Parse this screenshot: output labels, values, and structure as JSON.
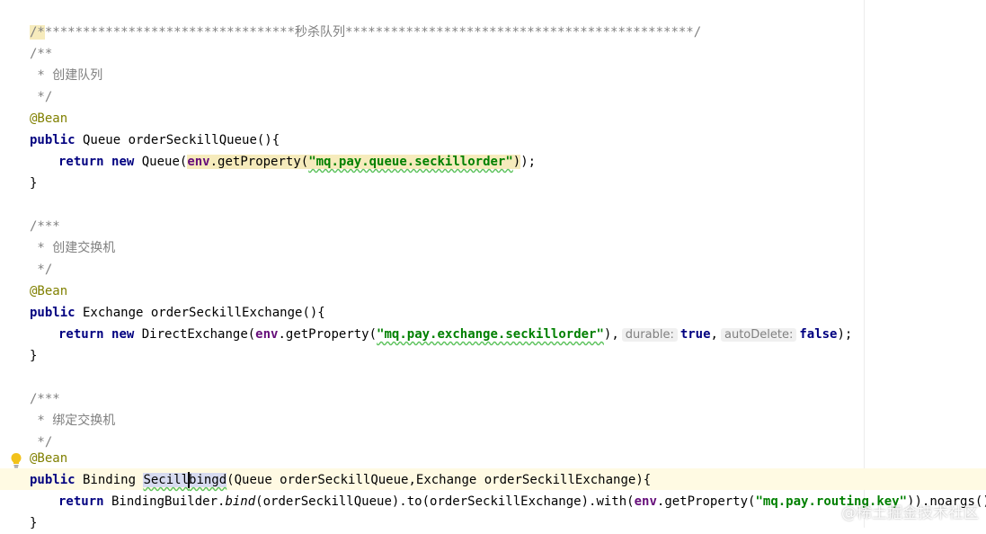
{
  "colors": {
    "keyword": "#000080",
    "annotation": "#808000",
    "string": "#008000",
    "comment": "#808080",
    "field": "#660e7a",
    "caret_row": "#fffae3"
  },
  "code": {
    "l1_stars_left": "/**********************************",
    "l1_title": "秒杀队列",
    "l1_stars_right": "**********************************************/",
    "l2": "/**",
    "l3_star": " * ",
    "l3_text": "创建队列",
    "l4": " */",
    "l5": "@Bean",
    "l6_kw": "public",
    "l6_rest": " Queue orderSeckillQueue(){",
    "l7_kw1": "return",
    "l7_kw2": "new",
    "l7_pre": " Queue(",
    "l7_field": "env",
    "l7_call": ".getProperty(",
    "l7_str": "\"mq.pay.queue.seckillorder\"",
    "l7_end": "));",
    "l8": "}",
    "l10": "/***",
    "l11_star": " * ",
    "l11_text": "创建交换机",
    "l12": " */",
    "l13": "@Bean",
    "l14_kw": "public",
    "l14_rest": " Exchange orderSeckillExchange(){",
    "l15_kw1": "return",
    "l15_kw2": "new",
    "l15_pre": " DirectExchange(",
    "l15_field": "env",
    "l15_call": ".getProperty(",
    "l15_str": "\"mq.pay.exchange.seckillorder\"",
    "l15_comma": "),",
    "l15_hint1": "durable:",
    "l15_true": "true",
    "l15_comma2": ",",
    "l15_hint2": "autoDelete:",
    "l15_false": "false",
    "l15_end": ");",
    "l16": "}",
    "l18": "/***",
    "l19_star": " * ",
    "l19_text": "绑定交换机",
    "l20": " */",
    "l21": "@Bean",
    "l22_kw": "public",
    "l22_type": " Binding ",
    "l22_name_a": "Secill",
    "l22_name_b": "bingd",
    "l22_rest": "(Queue orderSeckillQueue,Exchange orderSeckillExchange){",
    "l23_kw": "return",
    "l23_pre": " BindingBuilder.",
    "l23_bind": "bind",
    "l23_mid": "(orderSeckillQueue).to(orderSeckillExchange).with(",
    "l23_field": "env",
    "l23_call": ".getProperty(",
    "l23_str": "\"mq.pay.routing.key\"",
    "l23_end": ")).noargs();",
    "l24": "}"
  },
  "watermark": "@稀土掘金技术社区"
}
